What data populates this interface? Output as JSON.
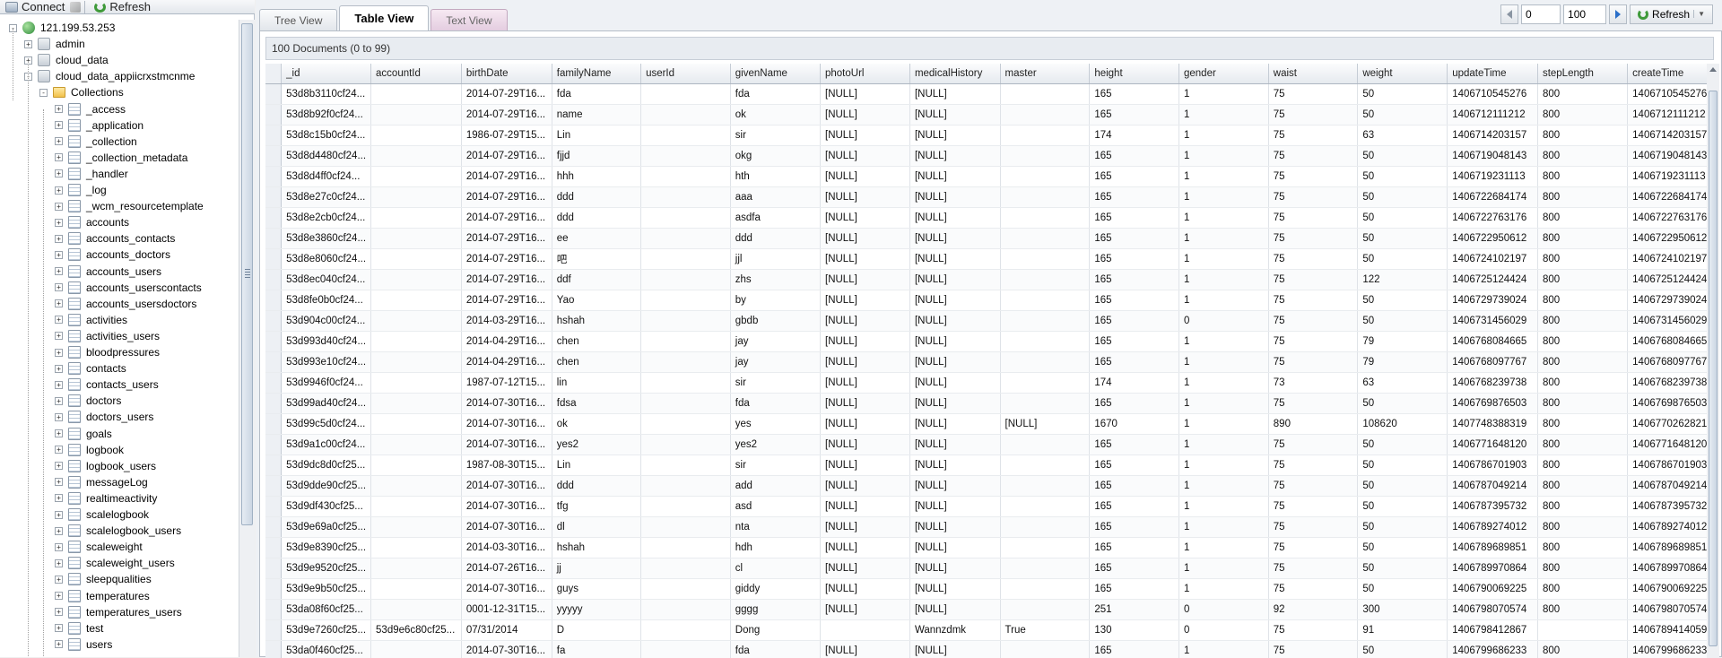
{
  "toolbar": {
    "connect_label": "Connect",
    "refresh_label": "Refresh"
  },
  "tree": {
    "server": "121.199.53.253",
    "databases": [
      "admin",
      "cloud_data",
      "cloud_data_appiicrxstmcnme"
    ],
    "collections_label": "Collections",
    "collections": [
      "_access",
      "_application",
      "_collection",
      "_collection_metadata",
      "_handler",
      "_log",
      "_wcm_resourcetemplate",
      "accounts",
      "accounts_contacts",
      "accounts_doctors",
      "accounts_users",
      "accounts_userscontacts",
      "accounts_usersdoctors",
      "activities",
      "activities_users",
      "bloodpressures",
      "contacts",
      "contacts_users",
      "doctors",
      "doctors_users",
      "goals",
      "logbook",
      "logbook_users",
      "messageLog",
      "realtimeactivity",
      "scalelogbook",
      "scalelogbook_users",
      "scaleweight",
      "scaleweight_users",
      "sleepqualities",
      "temperatures",
      "temperatures_users",
      "test",
      "users"
    ]
  },
  "tabs": [
    "Tree View",
    "Table View",
    "Text View"
  ],
  "pager": {
    "skip": "0",
    "limit": "100",
    "refresh_label": "Refresh"
  },
  "doc_info": "100 Documents (0 to 99)",
  "columns": [
    "_id",
    "accountId",
    "birthDate",
    "familyName",
    "userId",
    "givenName",
    "photoUrl",
    "medicalHistory",
    "master",
    "height",
    "gender",
    "waist",
    "weight",
    "updateTime",
    "stepLength",
    "createTime"
  ],
  "rows": [
    [
      "53d8b3110cf24...",
      "",
      "2014-07-29T16...",
      "fda",
      "",
      "fda",
      "[NULL]",
      "[NULL]",
      "",
      "165",
      "1",
      "75",
      "50",
      "1406710545276",
      "800",
      "1406710545276"
    ],
    [
      "53d8b92f0cf24...",
      "",
      "2014-07-29T16...",
      "name",
      "",
      "ok",
      "[NULL]",
      "[NULL]",
      "",
      "165",
      "1",
      "75",
      "50",
      "1406712111212",
      "800",
      "1406712111212"
    ],
    [
      "53d8c15b0cf24...",
      "",
      "1986-07-29T15...",
      "Lin",
      "",
      "sir",
      "[NULL]",
      "[NULL]",
      "",
      "174",
      "1",
      "75",
      "63",
      "1406714203157",
      "800",
      "1406714203157"
    ],
    [
      "53d8d4480cf24...",
      "",
      "2014-07-29T16...",
      "fjjd",
      "",
      "okg",
      "[NULL]",
      "[NULL]",
      "",
      "165",
      "1",
      "75",
      "50",
      "1406719048143",
      "800",
      "1406719048143"
    ],
    [
      "53d8d4ff0cf24...",
      "",
      "2014-07-29T16...",
      "hhh",
      "",
      "hth",
      "[NULL]",
      "[NULL]",
      "",
      "165",
      "1",
      "75",
      "50",
      "1406719231113",
      "800",
      "1406719231113"
    ],
    [
      "53d8e27c0cf24...",
      "",
      "2014-07-29T16...",
      "ddd",
      "",
      "aaa",
      "[NULL]",
      "[NULL]",
      "",
      "165",
      "1",
      "75",
      "50",
      "1406722684174",
      "800",
      "1406722684174"
    ],
    [
      "53d8e2cb0cf24...",
      "",
      "2014-07-29T16...",
      "ddd",
      "",
      "asdfa",
      "[NULL]",
      "[NULL]",
      "",
      "165",
      "1",
      "75",
      "50",
      "1406722763176",
      "800",
      "1406722763176"
    ],
    [
      "53d8e3860cf24...",
      "",
      "2014-07-29T16...",
      "ee",
      "",
      "ddd",
      "[NULL]",
      "[NULL]",
      "",
      "165",
      "1",
      "75",
      "50",
      "1406722950612",
      "800",
      "1406722950612"
    ],
    [
      "53d8e8060cf24...",
      "",
      "2014-07-29T16...",
      "吧",
      "",
      "jjl",
      "[NULL]",
      "[NULL]",
      "",
      "165",
      "1",
      "75",
      "50",
      "1406724102197",
      "800",
      "1406724102197"
    ],
    [
      "53d8ec040cf24...",
      "",
      "2014-07-29T16...",
      "ddf",
      "",
      "zhs",
      "[NULL]",
      "[NULL]",
      "",
      "165",
      "1",
      "75",
      "122",
      "1406725124424",
      "800",
      "1406725124424"
    ],
    [
      "53d8fe0b0cf24...",
      "",
      "2014-07-29T16...",
      "Yao",
      "",
      "by",
      "[NULL]",
      "[NULL]",
      "",
      "165",
      "1",
      "75",
      "50",
      "1406729739024",
      "800",
      "1406729739024"
    ],
    [
      "53d904c00cf24...",
      "",
      "2014-03-29T16...",
      "hshah",
      "",
      "gbdb",
      "[NULL]",
      "[NULL]",
      "",
      "165",
      "0",
      "75",
      "50",
      "1406731456029",
      "800",
      "1406731456029"
    ],
    [
      "53d993d40cf24...",
      "",
      "2014-04-29T16...",
      "chen",
      "",
      "jay",
      "[NULL]",
      "[NULL]",
      "",
      "165",
      "1",
      "75",
      "79",
      "1406768084665",
      "800",
      "1406768084665"
    ],
    [
      "53d993e10cf24...",
      "",
      "2014-04-29T16...",
      "chen",
      "",
      "jay",
      "[NULL]",
      "[NULL]",
      "",
      "165",
      "1",
      "75",
      "79",
      "1406768097767",
      "800",
      "1406768097767"
    ],
    [
      "53d9946f0cf24...",
      "",
      "1987-07-12T15...",
      "lin",
      "",
      "sir",
      "[NULL]",
      "[NULL]",
      "",
      "174",
      "1",
      "73",
      "63",
      "1406768239738",
      "800",
      "1406768239738"
    ],
    [
      "53d99ad40cf24...",
      "",
      "2014-07-30T16...",
      "fdsa",
      "",
      "fda",
      "[NULL]",
      "[NULL]",
      "",
      "165",
      "1",
      "75",
      "50",
      "1406769876503",
      "800",
      "1406769876503"
    ],
    [
      "53d99c5d0cf24...",
      "",
      "2014-07-30T16...",
      "ok",
      "",
      "yes",
      "[NULL]",
      "[NULL]",
      "[NULL]",
      "1670",
      "1",
      "890",
      "108620",
      "1407748388319",
      "800",
      "1406770262821"
    ],
    [
      "53d9a1c00cf24...",
      "",
      "2014-07-30T16...",
      "yes2",
      "",
      "yes2",
      "[NULL]",
      "[NULL]",
      "",
      "165",
      "1",
      "75",
      "50",
      "1406771648120",
      "800",
      "1406771648120"
    ],
    [
      "53d9dc8d0cf25...",
      "",
      "1987-08-30T15...",
      "Lin",
      "",
      "sir",
      "[NULL]",
      "[NULL]",
      "",
      "165",
      "1",
      "75",
      "50",
      "1406786701903",
      "800",
      "1406786701903"
    ],
    [
      "53d9dde90cf25...",
      "",
      "2014-07-30T16...",
      "ddd",
      "",
      "add",
      "[NULL]",
      "[NULL]",
      "",
      "165",
      "1",
      "75",
      "50",
      "1406787049214",
      "800",
      "1406787049214"
    ],
    [
      "53d9df430cf25...",
      "",
      "2014-07-30T16...",
      "tfg",
      "",
      "asd",
      "[NULL]",
      "[NULL]",
      "",
      "165",
      "1",
      "75",
      "50",
      "1406787395732",
      "800",
      "1406787395732"
    ],
    [
      "53d9e69a0cf25...",
      "",
      "2014-07-30T16...",
      "dl",
      "",
      "nta",
      "[NULL]",
      "[NULL]",
      "",
      "165",
      "1",
      "75",
      "50",
      "1406789274012",
      "800",
      "1406789274012"
    ],
    [
      "53d9e8390cf25...",
      "",
      "2014-03-30T16...",
      "hshah",
      "",
      "hdh",
      "[NULL]",
      "[NULL]",
      "",
      "165",
      "1",
      "75",
      "50",
      "1406789689851",
      "800",
      "1406789689851"
    ],
    [
      "53d9e9520cf25...",
      "",
      "2014-07-26T16...",
      "jj",
      "",
      "cl",
      "[NULL]",
      "[NULL]",
      "",
      "165",
      "1",
      "75",
      "50",
      "1406789970864",
      "800",
      "1406789970864"
    ],
    [
      "53d9e9b50cf25...",
      "",
      "2014-07-30T16...",
      "guys",
      "",
      "giddy",
      "[NULL]",
      "[NULL]",
      "",
      "165",
      "1",
      "75",
      "50",
      "1406790069225",
      "800",
      "1406790069225"
    ],
    [
      "53da08f60cf25...",
      "",
      "0001-12-31T15...",
      "yyyyy",
      "",
      "gggg",
      "[NULL]",
      "[NULL]",
      "",
      "251",
      "0",
      "92",
      "300",
      "1406798070574",
      "800",
      "1406798070574"
    ],
    [
      "53d9e7260cf25...",
      "53d9e6c80cf25...",
      "07/31/2014",
      "D",
      "",
      "Dong",
      "",
      "Wannzdmk",
      "True",
      "130",
      "0",
      "75",
      "91",
      "1406798412867",
      "",
      "1406789414059"
    ],
    [
      "53da0f460cf25...",
      "",
      "2014-07-30T16...",
      "fa",
      "",
      "fda",
      "[NULL]",
      "[NULL]",
      "",
      "165",
      "1",
      "75",
      "50",
      "1406799686233",
      "800",
      "1406799686233"
    ]
  ]
}
